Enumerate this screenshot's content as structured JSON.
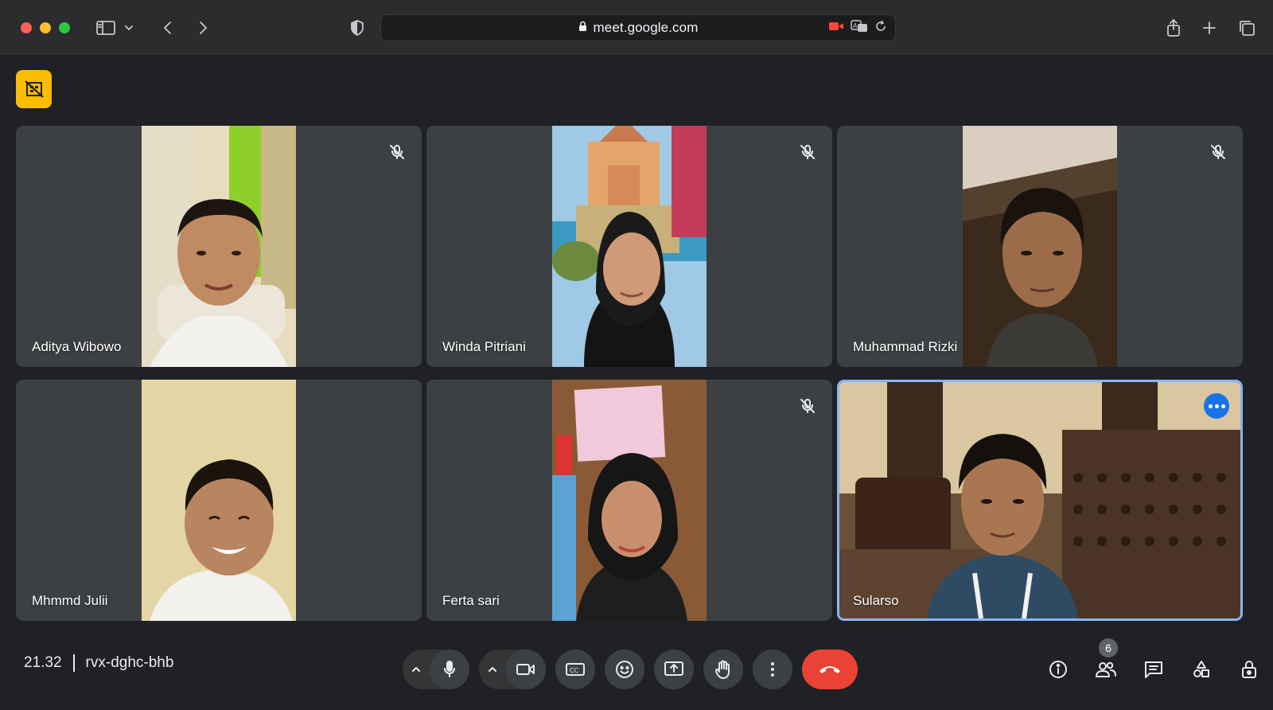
{
  "browser": {
    "url": "meet.google.com"
  },
  "meeting": {
    "time": "21.32",
    "code": "rvx-dghc-bhb",
    "participant_count": "6"
  },
  "participants": [
    {
      "name": "Aditya Wibowo",
      "muted": true
    },
    {
      "name": "Winda Pitriani",
      "muted": true
    },
    {
      "name": "Muhammad Rizki",
      "muted": true
    },
    {
      "name": "Mhmmd Julii",
      "muted": false
    },
    {
      "name": "Ferta sari",
      "muted": true
    },
    {
      "name": "Sularso",
      "muted": false,
      "active_speaker": true
    }
  ],
  "colors": {
    "background": "#202124",
    "tile": "#3c4043",
    "accent_blue": "#8ab4f8",
    "hangup_red": "#ea4335",
    "camera_off_badge": "#fbbc04"
  },
  "icons": {
    "camera_off_badge": "video-off-icon",
    "tile_mute": "mic-off-icon",
    "tile_more": "more-options-icon"
  }
}
